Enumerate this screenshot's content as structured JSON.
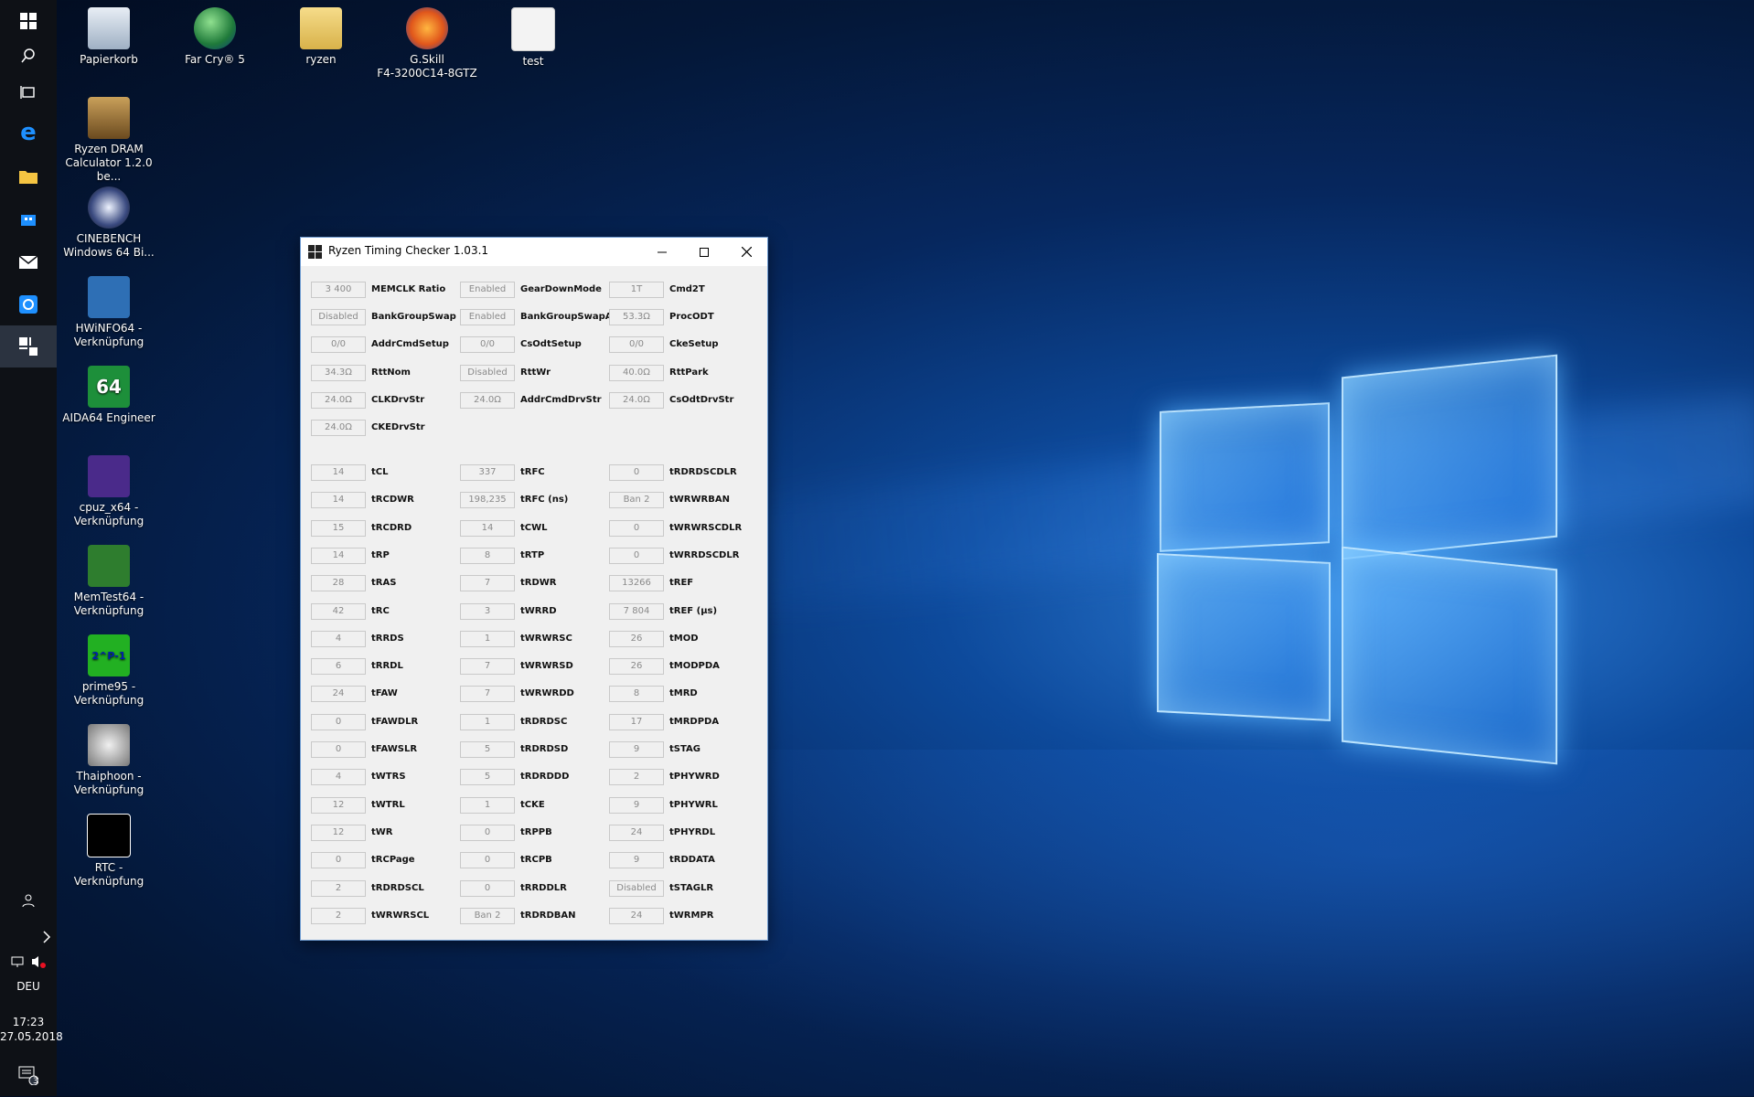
{
  "desktop": {
    "icons": [
      {
        "label": "Papierkorb",
        "icon": "recycle-bin-icon"
      },
      {
        "label": "Far Cry® 5",
        "icon": "globe-icon"
      },
      {
        "label": "ryzen",
        "icon": "folder-icon"
      },
      {
        "label": "G.Skill\nF4-3200C14-8GTZ",
        "icon": "firefox-icon"
      },
      {
        "label": "test",
        "icon": "spreadsheet-icon"
      },
      {
        "label": "Ryzen DRAM\nCalculator 1.2.0 be...",
        "icon": "dram-calculator-icon"
      },
      {
        "label": "CINEBENCH\nWindows 64 Bi...",
        "icon": "cinebench-icon"
      },
      {
        "label": "HWiNFO64 -\nVerknüpfung",
        "icon": "hwinfo-icon"
      },
      {
        "label": "AIDA64 Engineer",
        "icon": "aida64-icon",
        "glyph": "64"
      },
      {
        "label": "cpuz_x64 -\nVerknüpfung",
        "icon": "cpuz-icon"
      },
      {
        "label": "MemTest64 -\nVerknüpfung",
        "icon": "memtest-icon"
      },
      {
        "label": "prime95 -\nVerknüpfung",
        "icon": "prime95-icon",
        "glyph": "2^P-1"
      },
      {
        "label": "Thaiphoon -\nVerknüpfung",
        "icon": "thaiphoon-icon"
      },
      {
        "label": "RTC - Verknüpfung",
        "icon": "rtc-icon"
      }
    ]
  },
  "taskbar": {
    "language": "DEU",
    "time": "17:23",
    "date": "27.05.2018",
    "notification_count": "3",
    "buttons": [
      "windows-start-icon",
      "search-icon",
      "task-view-icon",
      "edge-icon",
      "file-explorer-icon",
      "store-icon",
      "mail-icon",
      "outlook-icon",
      "ryzen-timing-checker-icon"
    ],
    "colors": {
      "background": "#0e1116",
      "edge": "#1e90ff"
    }
  },
  "window": {
    "title": "Ryzen Timing Checker 1.03.1",
    "top_section": [
      [
        {
          "value": "3 400",
          "label": "MEMCLK Ratio"
        },
        {
          "value": "Enabled",
          "label": "GearDownMode"
        },
        {
          "value": "1T",
          "label": "Cmd2T"
        }
      ],
      [
        {
          "value": "Disabled",
          "label": "BankGroupSwap"
        },
        {
          "value": "Enabled",
          "label": "BankGroupSwapAlt"
        },
        {
          "value": "53.3Ω",
          "label": "ProcODT"
        }
      ],
      [
        {
          "value": "0/0",
          "label": "AddrCmdSetup"
        },
        {
          "value": "0/0",
          "label": "CsOdtSetup"
        },
        {
          "value": "0/0",
          "label": "CkeSetup"
        }
      ],
      [
        {
          "value": "34.3Ω",
          "label": "RttNom"
        },
        {
          "value": "Disabled",
          "label": "RttWr"
        },
        {
          "value": "40.0Ω",
          "label": "RttPark"
        }
      ],
      [
        {
          "value": "24.0Ω",
          "label": "CLKDrvStr"
        },
        {
          "value": "24.0Ω",
          "label": "AddrCmdDrvStr"
        },
        {
          "value": "24.0Ω",
          "label": "CsOdtDrvStr"
        }
      ],
      [
        {
          "value": "24.0Ω",
          "label": "CKEDrvStr"
        }
      ]
    ],
    "timings": [
      [
        {
          "value": "14",
          "label": "tCL"
        },
        {
          "value": "337",
          "label": "tRFC"
        },
        {
          "value": "0",
          "label": "tRDRDSCDLR"
        }
      ],
      [
        {
          "value": "14",
          "label": "tRCDWR"
        },
        {
          "value": "198,235",
          "label": "tRFC (ns)"
        },
        {
          "value": "Ban 2",
          "label": "tWRWRBAN"
        }
      ],
      [
        {
          "value": "15",
          "label": "tRCDRD"
        },
        {
          "value": "14",
          "label": "tCWL"
        },
        {
          "value": "0",
          "label": "tWRWRSCDLR"
        }
      ],
      [
        {
          "value": "14",
          "label": "tRP"
        },
        {
          "value": "8",
          "label": "tRTP"
        },
        {
          "value": "0",
          "label": "tWRRDSCDLR"
        }
      ],
      [
        {
          "value": "28",
          "label": "tRAS"
        },
        {
          "value": "7",
          "label": "tRDWR"
        },
        {
          "value": "13266",
          "label": "tREF"
        }
      ],
      [
        {
          "value": "42",
          "label": "tRC"
        },
        {
          "value": "3",
          "label": "tWRRD"
        },
        {
          "value": "7 804",
          "label": "tREF (µs)"
        }
      ],
      [
        {
          "value": "4",
          "label": "tRRDS"
        },
        {
          "value": "1",
          "label": "tWRWRSC"
        },
        {
          "value": "26",
          "label": "tMOD"
        }
      ],
      [
        {
          "value": "6",
          "label": "tRRDL"
        },
        {
          "value": "7",
          "label": "tWRWRSD"
        },
        {
          "value": "26",
          "label": "tMODPDA"
        }
      ],
      [
        {
          "value": "24",
          "label": "tFAW"
        },
        {
          "value": "7",
          "label": "tWRWRDD"
        },
        {
          "value": "8",
          "label": "tMRD"
        }
      ],
      [
        {
          "value": "0",
          "label": "tFAWDLR"
        },
        {
          "value": "1",
          "label": "tRDRDSC"
        },
        {
          "value": "17",
          "label": "tMRDPDA"
        }
      ],
      [
        {
          "value": "0",
          "label": "tFAWSLR"
        },
        {
          "value": "5",
          "label": "tRDRDSD"
        },
        {
          "value": "9",
          "label": "tSTAG"
        }
      ],
      [
        {
          "value": "4",
          "label": "tWTRS"
        },
        {
          "value": "5",
          "label": "tRDRDDD"
        },
        {
          "value": "2",
          "label": "tPHYWRD"
        }
      ],
      [
        {
          "value": "12",
          "label": "tWTRL"
        },
        {
          "value": "1",
          "label": "tCKE"
        },
        {
          "value": "9",
          "label": "tPHYWRL"
        }
      ],
      [
        {
          "value": "12",
          "label": "tWR"
        },
        {
          "value": "0",
          "label": "tRPPB"
        },
        {
          "value": "24",
          "label": "tPHYRDL"
        }
      ],
      [
        {
          "value": "0",
          "label": "tRCPage"
        },
        {
          "value": "0",
          "label": "tRCPB"
        },
        {
          "value": "9",
          "label": "tRDDATA"
        }
      ],
      [
        {
          "value": "2",
          "label": "tRDRDSCL"
        },
        {
          "value": "0",
          "label": "tRRDDLR"
        },
        {
          "value": "Disabled",
          "label": "tSTAGLR"
        }
      ],
      [
        {
          "value": "2",
          "label": "tWRWRSCL"
        },
        {
          "value": "Ban 2",
          "label": "tRDRDBAN"
        },
        {
          "value": "24",
          "label": "tWRMPR"
        }
      ]
    ]
  }
}
